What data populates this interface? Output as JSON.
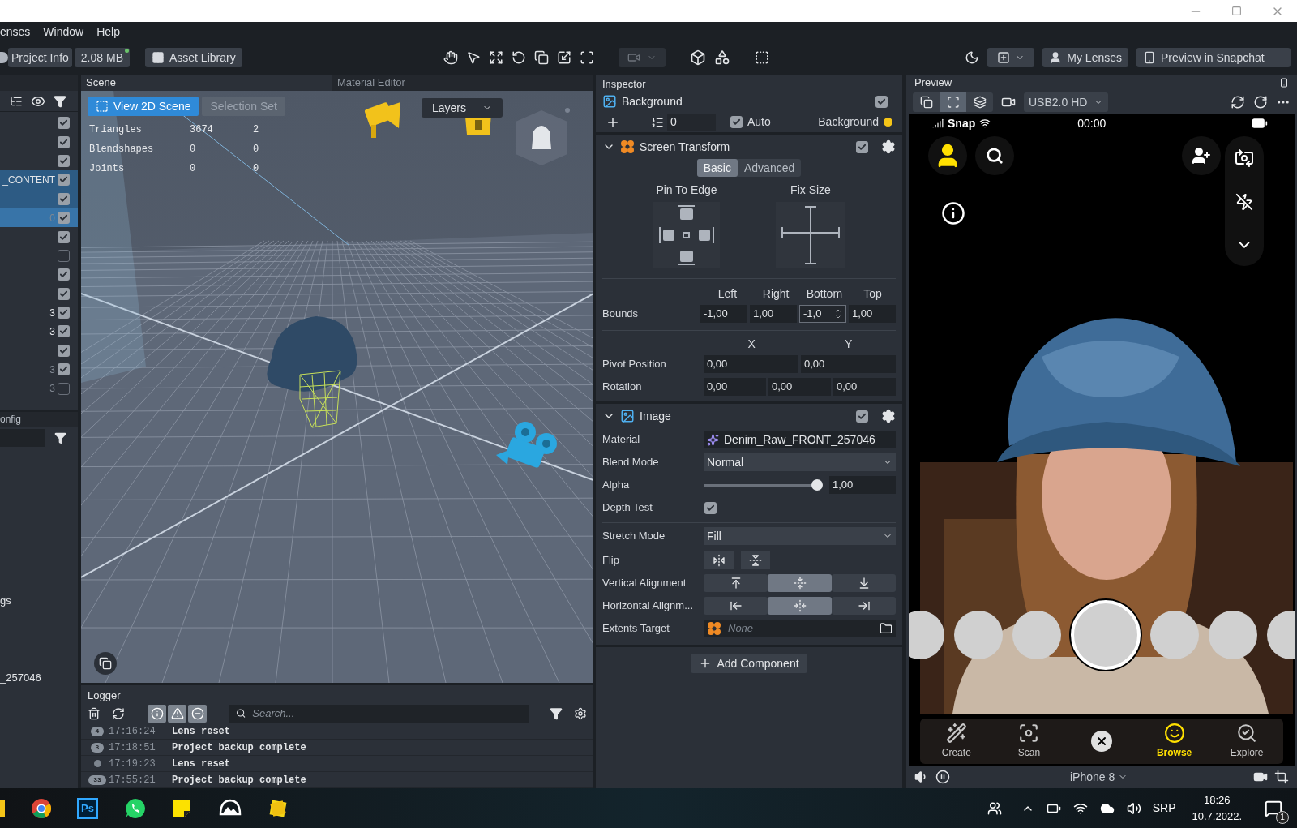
{
  "menu": [
    {
      "label": "enses"
    },
    {
      "label": "Window"
    },
    {
      "label": "Help"
    }
  ],
  "toolbar": {
    "project_info": "Project Info",
    "size": "2.08 MB",
    "asset_library": "Asset Library",
    "my_lenses": "My Lenses",
    "preview_snapchat": "Preview in Snapchat"
  },
  "hierarchy": {
    "rows": [
      {
        "checked": true,
        "selected": false,
        "highlighted": false
      },
      {
        "checked": true,
        "selected": false,
        "highlighted": false
      },
      {
        "checked": true,
        "selected": false,
        "highlighted": false
      },
      {
        "label": {
          "text": "_CONTENT",
          "dimmed": false
        },
        "checked": true,
        "selected": false,
        "highlighted": true
      },
      {
        "checked": true,
        "selected": false,
        "highlighted": true
      },
      {
        "label": {
          "text": "0",
          "dimmed": true
        },
        "checked": true,
        "selected": true,
        "highlighted": false
      },
      {
        "checked": true,
        "selected": false,
        "highlighted": false
      },
      {
        "checked": false,
        "selected": false,
        "highlighted": false
      },
      {
        "checked": true,
        "selected": false,
        "highlighted": false
      },
      {
        "checked": true,
        "selected": false,
        "highlighted": false
      },
      {
        "label": {
          "text": "3",
          "dimmed": false
        },
        "checked": true,
        "selected": false,
        "highlighted": false
      },
      {
        "label": {
          "text": "3",
          "dimmed": false
        },
        "checked": true,
        "selected": false,
        "highlighted": false
      },
      {
        "checked": true,
        "selected": false,
        "highlighted": false
      },
      {
        "label": {
          "text": "3",
          "dimmed": true
        },
        "checked": true,
        "selected": false,
        "highlighted": false
      },
      {
        "label": {
          "text": "3",
          "dimmed": true
        },
        "checked": false,
        "selected": false,
        "highlighted": false
      }
    ]
  },
  "config_panel": {
    "title": "onfig",
    "items": [
      "gs",
      "_257046"
    ]
  },
  "scene": {
    "tabs": [
      {
        "label": "Scene",
        "selected": true
      },
      {
        "label": "Material Editor",
        "selected": false
      }
    ],
    "view_buttons": [
      {
        "label": "View 2D Scene",
        "selected": true
      },
      {
        "label": "Selection Set",
        "selected": false
      }
    ],
    "layers": "Layers",
    "stats": [
      [
        "Triangles",
        "3674",
        "2"
      ],
      [
        "Blendshapes",
        "0",
        "0"
      ],
      [
        "Joints",
        "0",
        "0"
      ]
    ]
  },
  "logger": {
    "title": "Logger",
    "search_placeholder": "Search...",
    "entries": [
      {
        "count": "4",
        "time": "17:16:24",
        "message": "Lens reset"
      },
      {
        "count": "3",
        "time": "17:18:51",
        "message": "Project backup complete"
      },
      {
        "time": "17:19:23",
        "message": "Lens reset"
      },
      {
        "count": "33",
        "time": "17:55:21",
        "message": "Project backup complete"
      }
    ]
  },
  "inspector": {
    "title": "Inspector",
    "object": {
      "name": "Background",
      "enabled": true
    },
    "layer": {
      "order": "0",
      "auto_label": "Auto",
      "auto_checked": true,
      "layer_name": "Background"
    },
    "screen_transform": {
      "title": "Screen Transform",
      "expanded": true,
      "enabled": true,
      "tabs": [
        {
          "label": "Basic",
          "selected": true
        },
        {
          "label": "Advanced",
          "selected": false
        }
      ],
      "pin_label": "Pin To Edge",
      "fix_label": "Fix Size",
      "bounds_label": "Bounds",
      "bounds_columns": [
        "Left",
        "Right",
        "Bottom",
        "Top"
      ],
      "bounds": [
        {
          "value": "-1,00",
          "focused": false
        },
        {
          "value": "1,00",
          "focused": false
        },
        {
          "value": "-1,0",
          "focused": true
        },
        {
          "value": "1,00",
          "focused": false
        }
      ],
      "xy_columns": [
        "X",
        "Y"
      ],
      "pivot_label": "Pivot Position",
      "pivot": [
        "0,00",
        "0,00"
      ],
      "rotation_label": "Rotation",
      "rotation": [
        "0,00",
        "0,00",
        "0,00"
      ]
    },
    "image": {
      "title": "Image",
      "expanded": true,
      "enabled": true,
      "material_label": "Material",
      "material": "Denim_Raw_FRONT_257046",
      "blend_label": "Blend Mode",
      "blend": "Normal",
      "alpha": {
        "label": "Alpha",
        "level": 1,
        "reading": "1,00"
      },
      "depth_test": {
        "label": "Depth Test",
        "checked": true
      },
      "stretch_label": "Stretch Mode",
      "stretch": "Fill",
      "flip_label": "Flip",
      "vertical": {
        "label": "Vertical Alignment",
        "options": [
          {
            "selected": false
          },
          {
            "selected": true
          },
          {
            "selected": false
          }
        ]
      },
      "horizontal": {
        "label": "Horizontal Alignm...",
        "options": [
          {
            "selected": false
          },
          {
            "selected": true
          },
          {
            "selected": false
          }
        ]
      },
      "extents": {
        "label": "Extents Target",
        "placeholder": "None"
      }
    },
    "add_component": "Add Component"
  },
  "preview": {
    "title": "Preview",
    "modes": [
      {
        "selected": false
      },
      {
        "selected": true
      },
      {
        "selected": false
      }
    ],
    "camera": "USB2.0 HD",
    "status": {
      "carrier": "Snap",
      "time": "00:00"
    },
    "carousel": [
      {
        "selected": false
      },
      {
        "selected": false
      },
      {
        "selected": false
      },
      {
        "selected": true
      },
      {
        "selected": false
      },
      {
        "selected": false
      },
      {
        "selected": false
      }
    ],
    "nav": [
      {
        "kind": "create",
        "label": "Create",
        "selected": false
      },
      {
        "kind": "scan",
        "label": "Scan",
        "selected": false
      },
      {
        "kind": "close",
        "selected": false
      },
      {
        "kind": "browse",
        "label": "Browse",
        "selected": true
      },
      {
        "kind": "explore",
        "label": "Explore",
        "selected": false
      }
    ],
    "device": "iPhone 8"
  },
  "taskbar": {
    "ps_label": "Ps",
    "language": "SRP",
    "time": "18:26",
    "date": "10.7.2022.",
    "notifications": "1"
  }
}
